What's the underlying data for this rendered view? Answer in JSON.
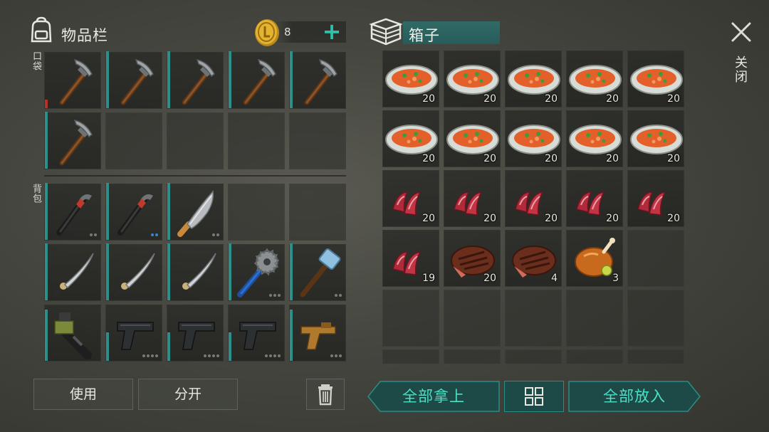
{
  "inventory": {
    "title": "物品栏",
    "coins": "8",
    "pocket_label": "口袋",
    "backpack_label": "背包"
  },
  "box": {
    "title": "箱子"
  },
  "close_label": "关闭",
  "pocket_slots": [
    {
      "item": "pickaxe",
      "durability": 0.15,
      "color": "red"
    },
    {
      "item": "pickaxe",
      "durability": 1.0,
      "color": "teal"
    },
    {
      "item": "pickaxe",
      "durability": 1.0,
      "color": "teal"
    },
    {
      "item": "pickaxe",
      "durability": 1.0,
      "color": "teal"
    },
    {
      "item": "pickaxe",
      "durability": 1.0,
      "color": "teal"
    },
    {
      "item": "pickaxe",
      "durability": 1.0,
      "color": "teal"
    },
    {
      "item": null
    },
    {
      "item": null
    },
    {
      "item": null
    },
    {
      "item": null
    }
  ],
  "backpack_slots": [
    {
      "item": "crowbar",
      "durability": 1.0,
      "dots": [
        "gray",
        "gray"
      ]
    },
    {
      "item": "crowbar",
      "durability": 1.0,
      "dots": [
        "blue",
        "blue"
      ]
    },
    {
      "item": "machete",
      "durability": 1.0,
      "dots": [
        "gray",
        "gray"
      ]
    },
    {
      "item": null
    },
    {
      "item": null
    },
    {
      "item": "katana",
      "durability": 1.0,
      "dots": []
    },
    {
      "item": "katana",
      "durability": 1.0,
      "dots": []
    },
    {
      "item": "katana",
      "durability": 1.0,
      "dots": []
    },
    {
      "item": "sawblade-mace",
      "durability": 1.0,
      "dots": [
        "gray",
        "gray",
        "gray"
      ]
    },
    {
      "item": "sledgehammer",
      "durability": 1.0,
      "dots": [
        "gray",
        "gray"
      ]
    },
    {
      "item": "crossbow-launcher",
      "durability": 0.9,
      "dots": []
    },
    {
      "item": "pistol",
      "durability": 0.5,
      "dots": [
        "gray",
        "gray",
        "gray",
        "gray"
      ]
    },
    {
      "item": "pistol",
      "durability": 0.5,
      "dots": [
        "gray",
        "gray",
        "gray",
        "gray"
      ]
    },
    {
      "item": "pistol",
      "durability": 0.5,
      "dots": [
        "gray",
        "gray",
        "gray",
        "gray"
      ]
    },
    {
      "item": "flare-gun",
      "durability": 0.9,
      "dots": [
        "gray",
        "gray",
        "gray"
      ]
    }
  ],
  "box_slots": [
    {
      "item": "stew",
      "qty": "20"
    },
    {
      "item": "stew",
      "qty": "20"
    },
    {
      "item": "stew",
      "qty": "20"
    },
    {
      "item": "stew",
      "qty": "20"
    },
    {
      "item": "stew",
      "qty": "20"
    },
    {
      "item": "stew",
      "qty": "20"
    },
    {
      "item": "stew",
      "qty": "20"
    },
    {
      "item": "stew",
      "qty": "20"
    },
    {
      "item": "stew",
      "qty": "20"
    },
    {
      "item": "stew",
      "qty": "20"
    },
    {
      "item": "bacon",
      "qty": "20"
    },
    {
      "item": "bacon",
      "qty": "20"
    },
    {
      "item": "bacon",
      "qty": "20"
    },
    {
      "item": "bacon",
      "qty": "20"
    },
    {
      "item": "bacon",
      "qty": "20"
    },
    {
      "item": "bacon",
      "qty": "19"
    },
    {
      "item": "steak",
      "qty": "20"
    },
    {
      "item": "steak",
      "qty": "4"
    },
    {
      "item": "roast-chicken",
      "qty": "3"
    },
    {
      "item": null
    },
    {
      "item": null
    },
    {
      "item": null
    },
    {
      "item": null
    },
    {
      "item": null
    },
    {
      "item": null
    },
    {
      "item": null
    },
    {
      "item": null
    },
    {
      "item": null
    },
    {
      "item": null
    },
    {
      "item": null
    }
  ],
  "buttons": {
    "use": "使用",
    "split": "分开",
    "take_all": "全部拿上",
    "put_all": "全部放入"
  },
  "colors": {
    "accent": "#2fc2a9",
    "durability": "#2c8f8a",
    "durability_low": "#b8302a",
    "button_text": "#4ce0c7"
  }
}
